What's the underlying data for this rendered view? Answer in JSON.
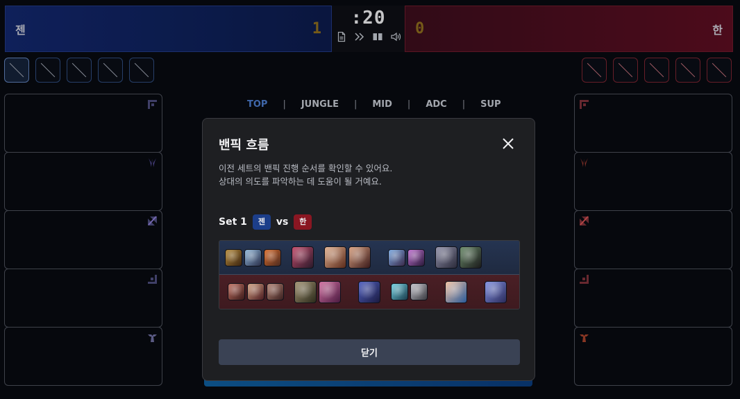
{
  "scoreboard": {
    "left_team": "젠",
    "left_score": "1",
    "right_team": "한",
    "right_score": "0",
    "timer": ":20",
    "controls": [
      "file-icon",
      "fast-forward-icon",
      "book-icon",
      "volume-icon"
    ]
  },
  "bans": {
    "left": [
      {
        "active": true
      },
      {
        "active": false
      },
      {
        "active": false
      },
      {
        "active": false
      },
      {
        "active": false
      }
    ],
    "right": [
      {},
      {},
      {},
      {},
      {}
    ]
  },
  "positions": {
    "tabs": [
      "TOP",
      "JUNGLE",
      "MID",
      "ADC",
      "SUP"
    ],
    "active": "TOP"
  },
  "roles": [
    "top-role-icon",
    "jungle-role-icon",
    "mid-role-icon",
    "adc-role-icon",
    "support-role-icon"
  ],
  "modal": {
    "title": "밴픽 흐름",
    "desc_line1": "이전 세트의 밴픽 진행 순서를 확인할 수 있어요.",
    "desc_line2": "상대의 의도를 파악하는 데 도움이 될 거예요.",
    "set_label": "Set 1",
    "blue_tag": "젠",
    "vs": "vs",
    "red_tag": "한",
    "close_label": "닫기"
  },
  "colors": {
    "blue_team": "#12266a",
    "red_team": "#5a0d20",
    "accent_tab": "#4b79c8",
    "score": "#8a6a1d"
  },
  "flow": {
    "blue": [
      {
        "size": "s",
        "c1": "#b58a3a",
        "c2": "#3b2410"
      },
      {
        "size": "s",
        "c1": "#8fb6d8",
        "c2": "#2a2f4a"
      },
      {
        "size": "s",
        "c1": "#d86a2a",
        "c2": "#4a2a20"
      },
      {
        "gap": "m"
      },
      {
        "size": "l",
        "c1": "#c24a6a",
        "c2": "#2a1a2a"
      },
      {
        "gap": "m"
      },
      {
        "size": "l",
        "c1": "#e0b090",
        "c2": "#5a2a1a"
      },
      {
        "size": "l",
        "c1": "#d8a080",
        "c2": "#3a1a1a"
      },
      {
        "gap": "l"
      },
      {
        "size": "s",
        "c1": "#7aa8e0",
        "c2": "#3a2a4a"
      },
      {
        "size": "s",
        "c1": "#c070d0",
        "c2": "#2a1a3a"
      },
      {
        "gap": "m"
      },
      {
        "size": "l",
        "c1": "#9090a8",
        "c2": "#2a2a3a"
      },
      {
        "size": "l",
        "c1": "#6a8a6a",
        "c2": "#1a1a1a"
      }
    ],
    "red": [
      {
        "gap": "s"
      },
      {
        "size": "s",
        "c1": "#c07060",
        "c2": "#3a1a1a"
      },
      {
        "size": "s",
        "c1": "#d0a080",
        "c2": "#4a1a20"
      },
      {
        "size": "s",
        "c1": "#b08070",
        "c2": "#3a2020"
      },
      {
        "gap": "m"
      },
      {
        "size": "l",
        "c1": "#a09070",
        "c2": "#2a2a1a"
      },
      {
        "size": "l",
        "c1": "#d070a0",
        "c2": "#4a1a40"
      },
      {
        "gap": "l"
      },
      {
        "size": "l",
        "c1": "#5060c0",
        "c2": "#1a1a40"
      },
      {
        "gap": "m"
      },
      {
        "size": "s",
        "c1": "#70d0e0",
        "c2": "#1a3a4a"
      },
      {
        "size": "s",
        "c1": "#c0c0c8",
        "c2": "#3a3a40"
      },
      {
        "gap": "l"
      },
      {
        "size": "l",
        "c1": "#f0c0a0",
        "c2": "#2a5a9a"
      },
      {
        "gap": "l"
      },
      {
        "size": "l",
        "c1": "#8090e0",
        "c2": "#2a2a5a"
      }
    ]
  }
}
